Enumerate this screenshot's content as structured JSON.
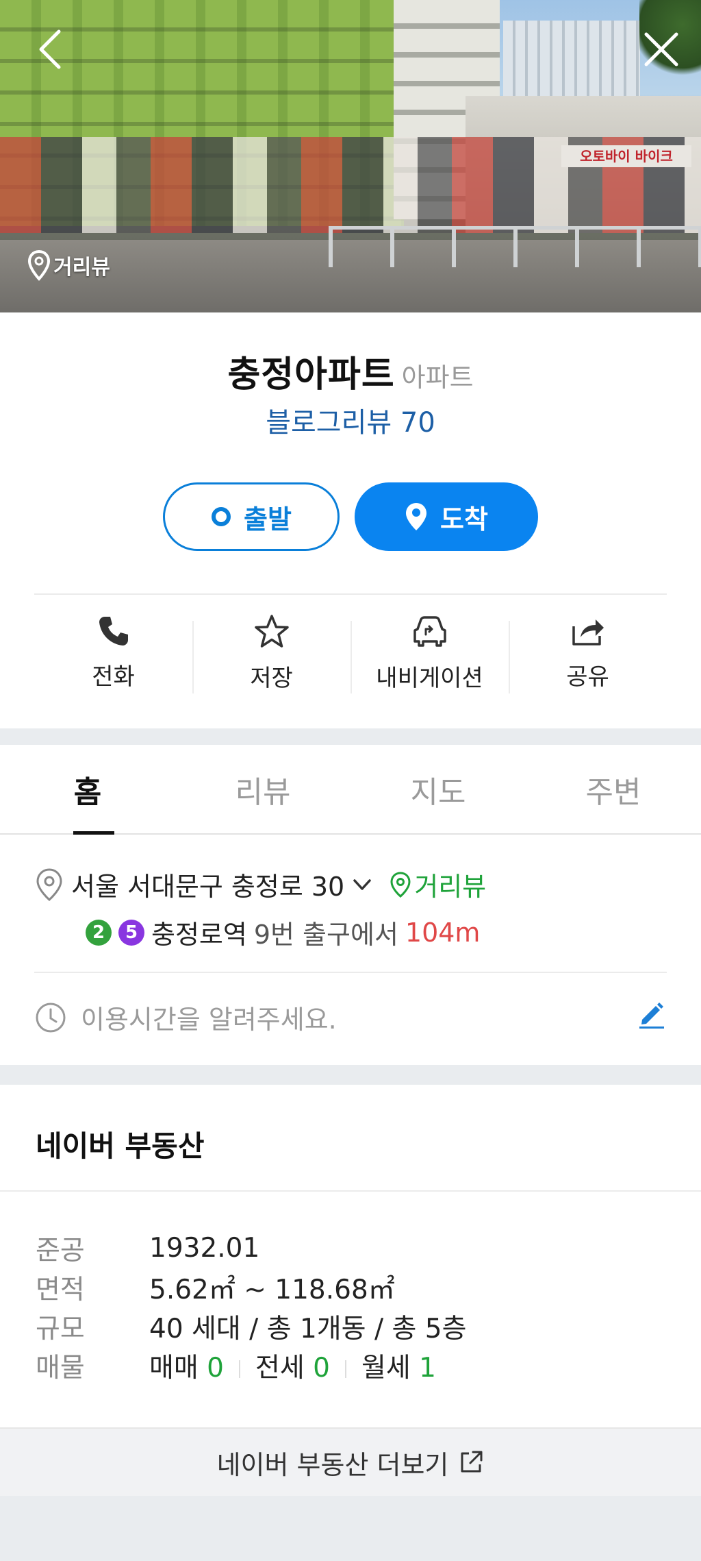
{
  "hero": {
    "back_icon": "back-arrow-icon",
    "close_icon": "close-icon",
    "street_view_label": "거리뷰",
    "shop_sign": "오토바이 바이크"
  },
  "place": {
    "name": "충정아파트",
    "category": "아파트",
    "blog_review": "블로그리뷰 70"
  },
  "route": {
    "start_label": "출발",
    "arrive_label": "도착"
  },
  "actions": [
    {
      "label": "전화",
      "icon": "phone-icon"
    },
    {
      "label": "저장",
      "icon": "star-icon"
    },
    {
      "label": "내비게이션",
      "icon": "navigation-car-icon"
    },
    {
      "label": "공유",
      "icon": "share-icon"
    }
  ],
  "tabs": [
    {
      "label": "홈",
      "active": true
    },
    {
      "label": "리뷰",
      "active": false
    },
    {
      "label": "지도",
      "active": false
    },
    {
      "label": "주변",
      "active": false
    }
  ],
  "details": {
    "address": "서울 서대문구 충정로 30",
    "street_view": "거리뷰",
    "subway_lines": [
      "2",
      "5"
    ],
    "subway_station": "충정로역",
    "subway_exit": "9번 출구에서",
    "subway_distance": "104m",
    "hours_placeholder": "이용시간을 알려주세요."
  },
  "real_estate": {
    "title": "네이버 부동산",
    "rows": {
      "completion_key": "준공",
      "completion_val": "1932.01",
      "area_key": "면적",
      "area_val": "5.62㎡ ~ 118.68㎡",
      "scale_key": "규모",
      "scale_val": "40 세대 / 총 1개동 / 총 5층",
      "listing_key": "매물",
      "sale_label": "매매",
      "sale_count": "0",
      "jeonse_label": "전세",
      "jeonse_count": "0",
      "monthly_label": "월세",
      "monthly_count": "1"
    },
    "more_label": "네이버 부동산 더보기"
  },
  "colors": {
    "accent_blue": "#0a84f0",
    "review_blue": "#1d5fa6",
    "green": "#1fa33a",
    "distance_red": "#e04848",
    "line2": "#33a23d",
    "line5": "#8936e0"
  }
}
